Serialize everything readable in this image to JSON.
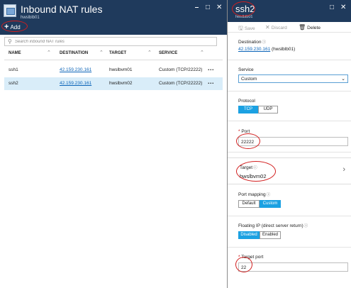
{
  "left_blade": {
    "title": "Inbound NAT rules",
    "subtitle": "hwslblb01",
    "add_label": "Add",
    "search_placeholder": "Search inbound NAT rules",
    "columns": [
      "NAME",
      "DESTINATION",
      "TARGET",
      "SERVICE"
    ],
    "rows": [
      {
        "name": "ssh1",
        "destination": "42.159.230.161",
        "target": "hwslbvm01",
        "service": "Custom (TCP/22222)",
        "selected": false
      },
      {
        "name": "ssh2",
        "destination": "42.159.230.161",
        "target": "hwslbvm02",
        "service": "Custom (TCP/22222)",
        "selected": true
      }
    ],
    "row_menu": "..."
  },
  "right_blade": {
    "title": "ssh2",
    "subtitle": "hwslblb01",
    "save_label": "Save",
    "discard_label": "Discard",
    "delete_label": "Delete",
    "destination_label": "Destination",
    "destination_ip": "42.159.230.161",
    "destination_suffix": "(hwslblb01)",
    "service_label": "Service",
    "service_value": "Custom",
    "protocol_label": "Protocol",
    "protocol_options": [
      "TCP",
      "UDP"
    ],
    "protocol_selected": "TCP",
    "port_label": "Port",
    "port_value": "22222",
    "target_label": "Target",
    "target_value": "hwslbvm02",
    "port_mapping_label": "Port mapping",
    "port_mapping_options": [
      "Default",
      "Custom"
    ],
    "port_mapping_selected": "Custom",
    "floating_ip_label": "Floating IP (direct server return)",
    "floating_ip_options": [
      "Disabled",
      "Enabled"
    ],
    "floating_ip_selected": "Disabled",
    "target_port_label": "Target port",
    "target_port_value": "22",
    "required_marker": "*",
    "info_marker": "ⓘ"
  },
  "icons": [
    "blade-icon",
    "pin-icon",
    "maximize-icon",
    "close-icon",
    "search-icon",
    "save-icon",
    "discard-icon",
    "delete-icon",
    "chevron-down-icon",
    "chevron-right-icon",
    "info-icon"
  ],
  "colors": {
    "header_bg": "#1f3a5c",
    "selected_row": "#d9edf9",
    "toggle_on": "#1ba1e2",
    "link": "#0b64b8",
    "annotation": "#d21f1f"
  }
}
